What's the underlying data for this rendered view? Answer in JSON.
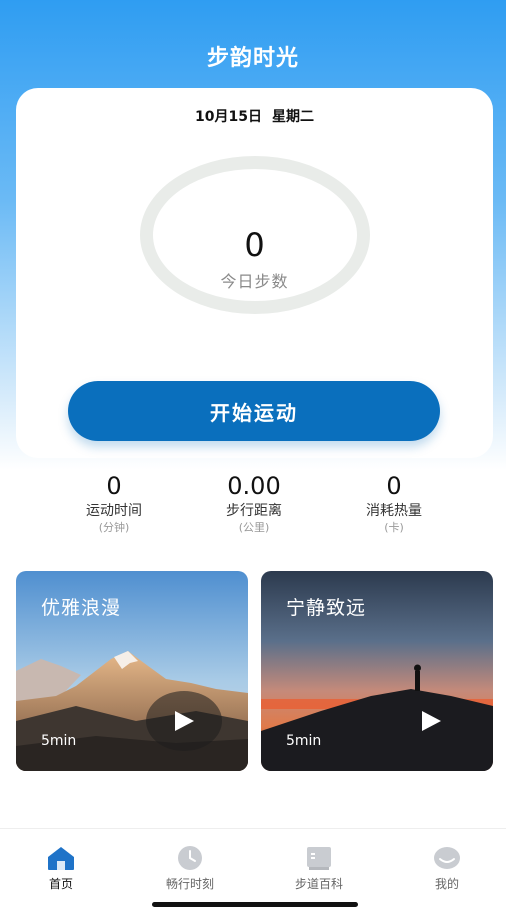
{
  "app": {
    "title": "步韵时光"
  },
  "today": {
    "date": "10月15日",
    "weekday": "星期二",
    "steps": "0",
    "steps_label": "今日步数",
    "start_button": "开始运动"
  },
  "stats": [
    {
      "value": "0",
      "label": "运动时间",
      "unit": "(分钟)"
    },
    {
      "value": "0.00",
      "label": "步行距离",
      "unit": "(公里)"
    },
    {
      "value": "0",
      "label": "消耗热量",
      "unit": "(卡)"
    }
  ],
  "videos": [
    {
      "title": "优雅浪漫",
      "duration": "5min",
      "icon": "play-icon"
    },
    {
      "title": "宁静致远",
      "duration": "5min",
      "icon": "play-icon"
    }
  ],
  "tabbar": {
    "items": [
      {
        "label": "首页",
        "icon": "home-icon",
        "active": true
      },
      {
        "label": "畅行时刻",
        "icon": "clock-icon",
        "active": false
      },
      {
        "label": "步道百科",
        "icon": "book-icon",
        "active": false
      },
      {
        "label": "我的",
        "icon": "profile-icon",
        "active": false
      }
    ]
  },
  "colors": {
    "accent": "#0a6fbd",
    "header_gradient_top": "#2f9df2",
    "active_tab": "#1f73c8",
    "inactive_tab_icon": "#c9ccd1"
  }
}
